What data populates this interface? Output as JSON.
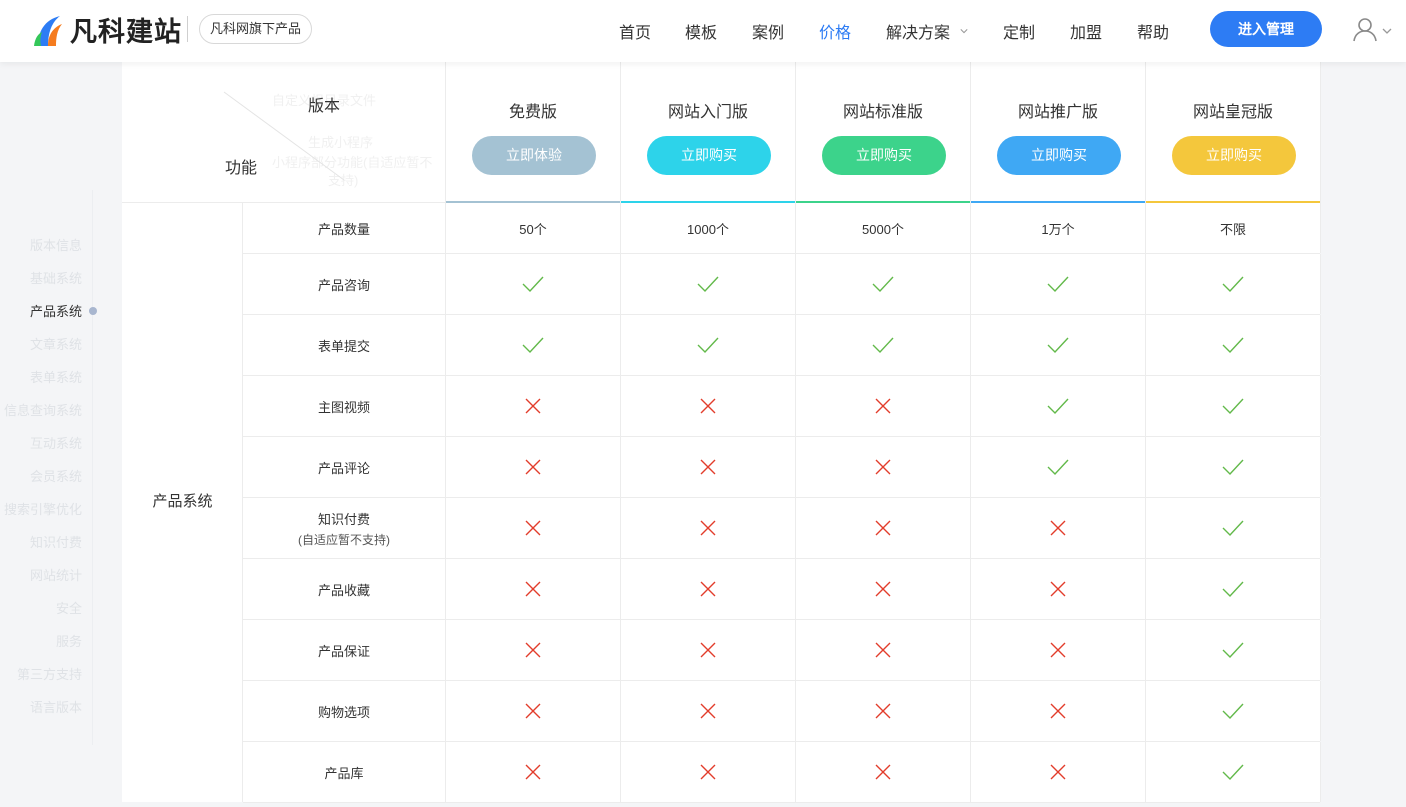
{
  "header": {
    "logo_text": "凡科建站",
    "badge": "凡科网旗下产品",
    "nav": [
      {
        "label": "首页",
        "active": false
      },
      {
        "label": "模板",
        "active": false
      },
      {
        "label": "案例",
        "active": false
      },
      {
        "label": "价格",
        "active": true
      },
      {
        "label": "解决方案",
        "active": false,
        "dropdown": true
      },
      {
        "label": "定制",
        "active": false
      },
      {
        "label": "加盟",
        "active": false
      },
      {
        "label": "帮助",
        "active": false
      }
    ],
    "enter_button": "进入管理",
    "colors": {
      "accent": "#2d7cf4"
    }
  },
  "side_nav": [
    {
      "label": "版本信息",
      "active": false
    },
    {
      "label": "基础系统",
      "active": false
    },
    {
      "label": "产品系统",
      "active": true
    },
    {
      "label": "文章系统",
      "active": false
    },
    {
      "label": "表单系统",
      "active": false
    },
    {
      "label": "信息查询系统",
      "active": false
    },
    {
      "label": "互动系统",
      "active": false
    },
    {
      "label": "会员系统",
      "active": false
    },
    {
      "label": "搜索引擎优化",
      "active": false
    },
    {
      "label": "知识付费",
      "active": false
    },
    {
      "label": "网站统计",
      "active": false
    },
    {
      "label": "安全",
      "active": false
    },
    {
      "label": "服务",
      "active": false
    },
    {
      "label": "第三方支持",
      "active": false
    },
    {
      "label": "语言版本",
      "active": false
    }
  ],
  "table": {
    "corner": {
      "version_label": "版本",
      "function_label": "功能",
      "ghost_lines": [
        "自定义根目录文件",
        "生成小程序",
        "小程序部分功能(自适应暂不",
        "支持)"
      ]
    },
    "plans": [
      {
        "name": "免费版",
        "button": "立即体验",
        "color": "#a4c2d3",
        "bar": "#a4c2d3"
      },
      {
        "name": "网站入门版",
        "button": "立即购买",
        "color": "#2dd3ea",
        "bar": "#2dd3ea"
      },
      {
        "name": "网站标准版",
        "button": "立即购买",
        "color": "#3cd38b",
        "bar": "#3cd38b"
      },
      {
        "name": "网站推广版",
        "button": "立即购买",
        "color": "#3fa8f4",
        "bar": "#3fa8f4"
      },
      {
        "name": "网站皇冠版",
        "button": "立即购买",
        "color": "#f4c73c",
        "bar": "#f4c73c"
      }
    ],
    "category": "产品系统",
    "rows": [
      {
        "label": "产品数量",
        "sub": "",
        "values": [
          "50个",
          "1000个",
          "5000个",
          "1万个",
          "不限"
        ]
      },
      {
        "label": "产品咨询",
        "sub": "",
        "values": [
          "check",
          "check",
          "check",
          "check",
          "check"
        ]
      },
      {
        "label": "表单提交",
        "sub": "",
        "values": [
          "check",
          "check",
          "check",
          "check",
          "check"
        ]
      },
      {
        "label": "主图视频",
        "sub": "",
        "values": [
          "cross",
          "cross",
          "cross",
          "check",
          "check"
        ]
      },
      {
        "label": "产品评论",
        "sub": "",
        "values": [
          "cross",
          "cross",
          "cross",
          "check",
          "check"
        ]
      },
      {
        "label": "知识付费",
        "sub": "(自适应暂不支持)",
        "values": [
          "cross",
          "cross",
          "cross",
          "cross",
          "check"
        ]
      },
      {
        "label": "产品收藏",
        "sub": "",
        "values": [
          "cross",
          "cross",
          "cross",
          "cross",
          "check"
        ]
      },
      {
        "label": "产品保证",
        "sub": "",
        "values": [
          "cross",
          "cross",
          "cross",
          "cross",
          "check"
        ]
      },
      {
        "label": "购物选项",
        "sub": "",
        "values": [
          "cross",
          "cross",
          "cross",
          "cross",
          "check"
        ]
      },
      {
        "label": "产品库",
        "sub": "",
        "values": [
          "cross",
          "cross",
          "cross",
          "cross",
          "check"
        ]
      }
    ],
    "mark_colors": {
      "check": "#62b94a",
      "cross": "#e23d2b"
    }
  }
}
